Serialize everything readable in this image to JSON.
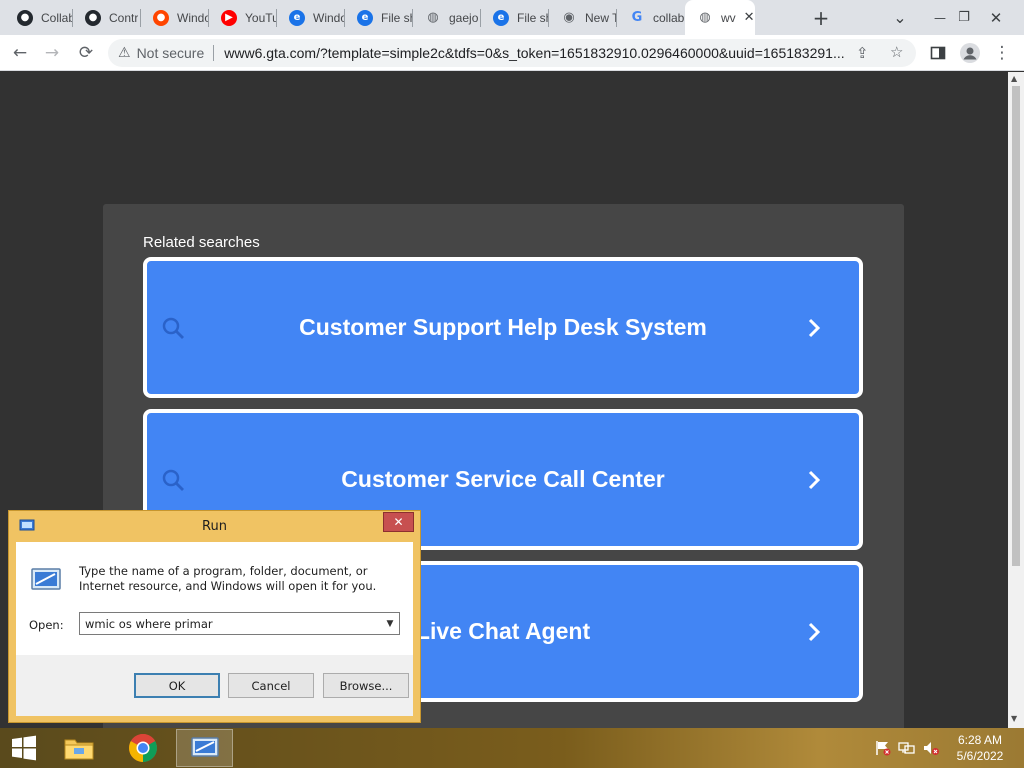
{
  "browser": {
    "tabs": [
      {
        "title": "Collab",
        "favicon": "github-icon",
        "color": "#24292f"
      },
      {
        "title": "Contr",
        "favicon": "github-icon",
        "color": "#24292f"
      },
      {
        "title": "Windo",
        "favicon": "reddit-icon",
        "color": "#ff4500"
      },
      {
        "title": "YouTu",
        "favicon": "youtube-icon",
        "color": "#ff0000"
      },
      {
        "title": "Windo",
        "favicon": "edge-icon",
        "color": "#1a73e8"
      },
      {
        "title": "File sh",
        "favicon": "edge-icon",
        "color": "#1a73e8"
      },
      {
        "title": "gaejo",
        "favicon": "globe-icon",
        "color": "#5f6368"
      },
      {
        "title": "File sh",
        "favicon": "edge-icon",
        "color": "#1a73e8"
      },
      {
        "title": "New T",
        "favicon": "chrome-icon",
        "color": "#5f6368"
      },
      {
        "title": "collab",
        "favicon": "google-icon",
        "color": "#4285f4"
      },
      {
        "title": "wv",
        "favicon": "globe-icon",
        "color": "#5f6368",
        "active": true
      }
    ],
    "new_tab_symbol": "+",
    "omnibox": {
      "security_label": "Not secure",
      "url": "www6.gta.com/?template=simple2c&tdfs=0&s_token=1651832910.0296460000&uuid=165183291..."
    }
  },
  "page": {
    "related_title": "Related searches",
    "cards": [
      {
        "label": "Customer Support Help Desk System"
      },
      {
        "label": "Customer Service Call Center"
      },
      {
        "label": "Live Chat Agent"
      }
    ]
  },
  "run_dialog": {
    "title": "Run",
    "description": "Type the name of a program, folder, document, or Internet resource, and Windows will open it for you.",
    "open_label": "Open:",
    "input_value": "wmic os where primar",
    "buttons": {
      "ok": "OK",
      "cancel": "Cancel",
      "browse": "Browse..."
    }
  },
  "taskbar": {
    "time": "6:28 AM",
    "date": "5/6/2022"
  },
  "colors": {
    "card_blue": "#4285f4",
    "page_bg": "#323232",
    "panel_bg": "#464646",
    "dialog_frame": "#f0c363"
  }
}
